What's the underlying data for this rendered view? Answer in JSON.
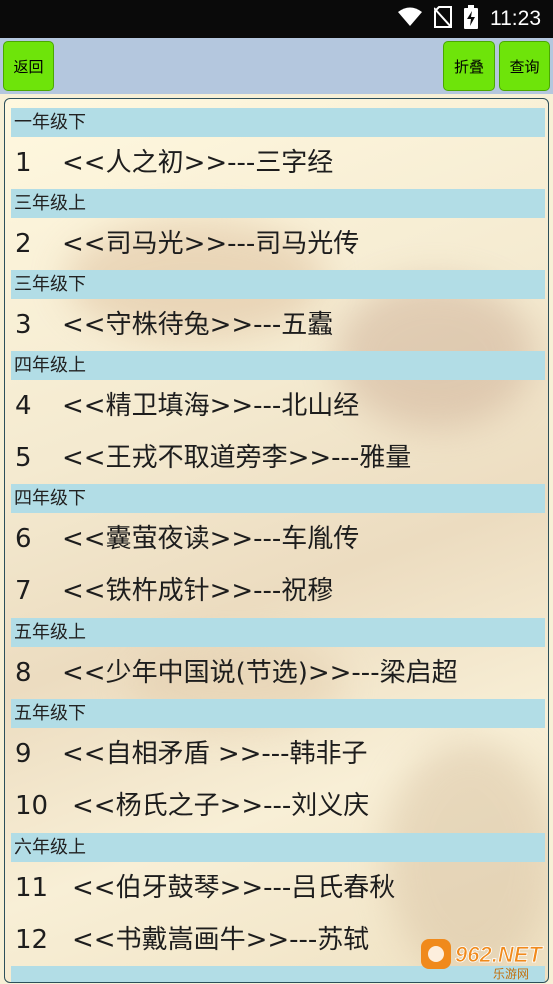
{
  "status_bar": {
    "time": "11:23",
    "icons": [
      "wifi-icon",
      "no-sim-icon",
      "battery-charging-icon"
    ]
  },
  "toolbar": {
    "back_label": "返回",
    "fold_label": "折叠",
    "query_label": "查询"
  },
  "sections": [
    {
      "header": "一年级下",
      "items": [
        {
          "num": "1",
          "title": "<<人之初>>---三字经"
        }
      ]
    },
    {
      "header": "三年级上",
      "items": [
        {
          "num": "2",
          "title": "<<司马光>>---司马光传"
        }
      ]
    },
    {
      "header": "三年级下",
      "items": [
        {
          "num": "3",
          "title": "<<守株待兔>>---五蠹"
        }
      ]
    },
    {
      "header": "四年级上",
      "items": [
        {
          "num": "4",
          "title": "<<精卫填海>>---北山经"
        },
        {
          "num": "5",
          "title": "<<王戎不取道旁李>>---雅量"
        }
      ]
    },
    {
      "header": "四年级下",
      "items": [
        {
          "num": "6",
          "title": "<<囊萤夜读>>---车胤传"
        },
        {
          "num": "7",
          "title": "<<铁杵成针>>---祝穆"
        }
      ]
    },
    {
      "header": "五年级上",
      "items": [
        {
          "num": "8",
          "title": "<<少年中国说(节选)>>---梁启超"
        }
      ]
    },
    {
      "header": "五年级下",
      "items": [
        {
          "num": "9",
          "title": "<<自相矛盾 >>---韩非子"
        },
        {
          "num": "10",
          "title": "<<杨氏之子>>---刘义庆"
        }
      ]
    },
    {
      "header": "六年级上",
      "items": [
        {
          "num": "11",
          "title": "<<伯牙鼓琴>>---吕氏春秋"
        },
        {
          "num": "12",
          "title": "<<书戴嵩画牛>>---苏轼"
        }
      ]
    }
  ],
  "watermark": {
    "brand": "962.NET",
    "sub": "乐游网"
  },
  "colors": {
    "button_green": "#6ee40a",
    "toolbar_blue": "#b4c7de",
    "section_header": "#b2dde6",
    "status_bar": "#0a0a0a"
  }
}
